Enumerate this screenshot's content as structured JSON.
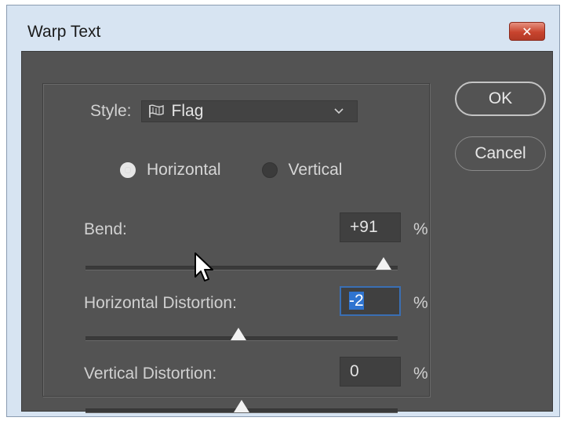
{
  "window": {
    "title": "Warp Text",
    "close_glyph": "✕"
  },
  "style": {
    "label": "Style:",
    "value": "Flag",
    "icon": "flag-icon"
  },
  "orientation": {
    "horizontal_label": "Horizontal",
    "vertical_label": "Vertical",
    "selected": "Horizontal"
  },
  "params": {
    "bend": {
      "label": "Bend:",
      "value": "+91",
      "unit": "%",
      "slider_percent": 95.5
    },
    "horizontal_distortion": {
      "label": "Horizontal Distortion:",
      "value": "-2",
      "unit": "%",
      "slider_percent": 49
    },
    "vertical_distortion": {
      "label": "Vertical Distortion:",
      "value": "0",
      "unit": "%",
      "slider_percent": 50
    }
  },
  "buttons": {
    "ok": "OK",
    "cancel": "Cancel"
  },
  "colors": {
    "panel": "#535353",
    "selection": "#2f74d0"
  }
}
